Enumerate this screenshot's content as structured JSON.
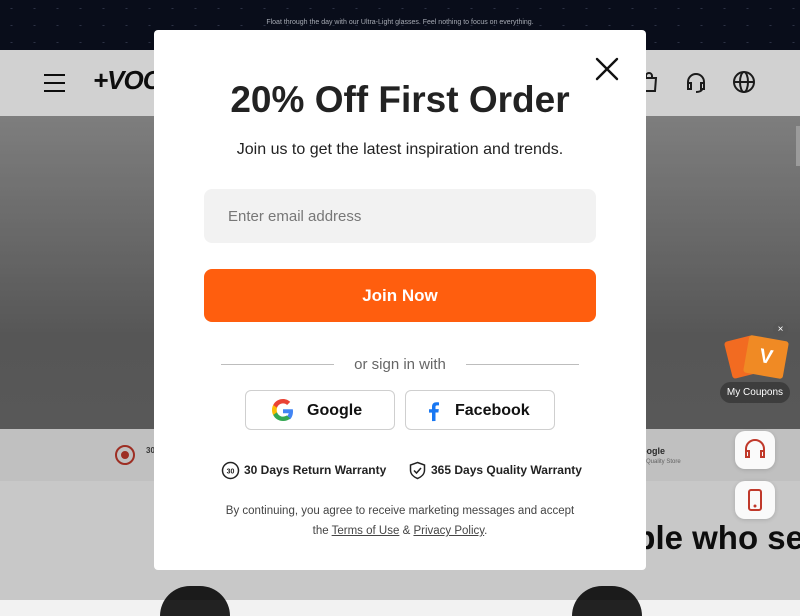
{
  "announcement": "Float through the day with our Ultra-Light glasses. Feel nothing to focus on everything.",
  "header": {
    "logo": "+VOO"
  },
  "badges": {
    "left_title": "30",
    "right_title": "oogle",
    "right_sub": "p Quality Store"
  },
  "people_heading": "ple who se",
  "coupon": {
    "label": "My Coupons",
    "mark": "V"
  },
  "modal": {
    "title": "20% Off First Order",
    "subtitle": "Join us to get the latest inspiration and trends.",
    "email_placeholder": "Enter email address",
    "join_label": "Join Now",
    "or_text": "or sign in with",
    "google_label": "Google",
    "facebook_label": "Facebook",
    "warranty_return": "30 Days Return Warranty",
    "warranty_quality": "365 Days Quality Warranty",
    "terms_prefix": "By continuing, you agree to receive marketing messages and accept",
    "terms_the": "the",
    "terms_link": "Terms of Use",
    "amp": "&",
    "privacy_link": "Privacy Policy",
    "period": "."
  },
  "colors": {
    "accent": "#ff5e0e",
    "facebook": "#1877f2"
  }
}
